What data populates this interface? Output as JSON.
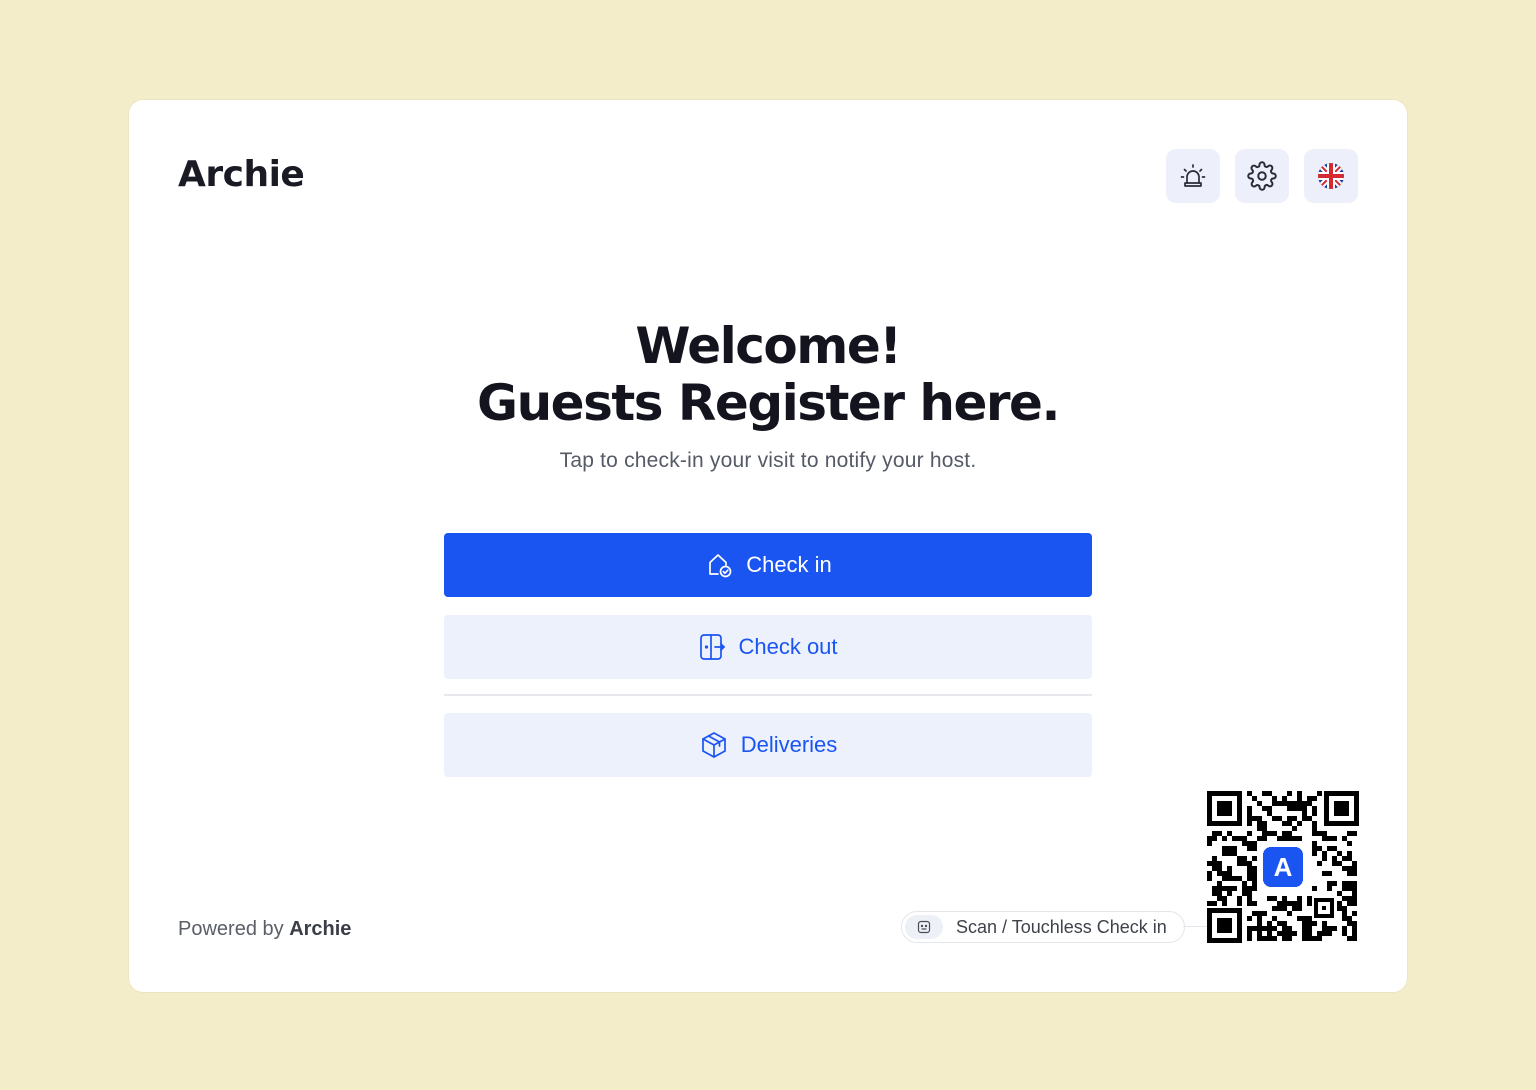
{
  "brand": {
    "name": "Archie"
  },
  "header_actions": [
    {
      "name": "alarm-icon"
    },
    {
      "name": "gear-icon"
    },
    {
      "name": "uk-flag-icon"
    }
  ],
  "hero": {
    "title_line1": "Welcome!",
    "title_line2": "Guests Register here.",
    "subtitle": "Tap to check-in your visit to notify your host."
  },
  "actions": {
    "check_in": "Check in",
    "check_out": "Check out",
    "deliveries": "Deliveries"
  },
  "footer": {
    "powered_prefix": "Powered by",
    "powered_brand": "Archie",
    "scan_label": "Scan / Touchless Check in",
    "qr_badge_letter": "A"
  },
  "colors": {
    "background": "#f4edca",
    "primary": "#1a55f2",
    "secondary_bg": "#edf1fc"
  }
}
